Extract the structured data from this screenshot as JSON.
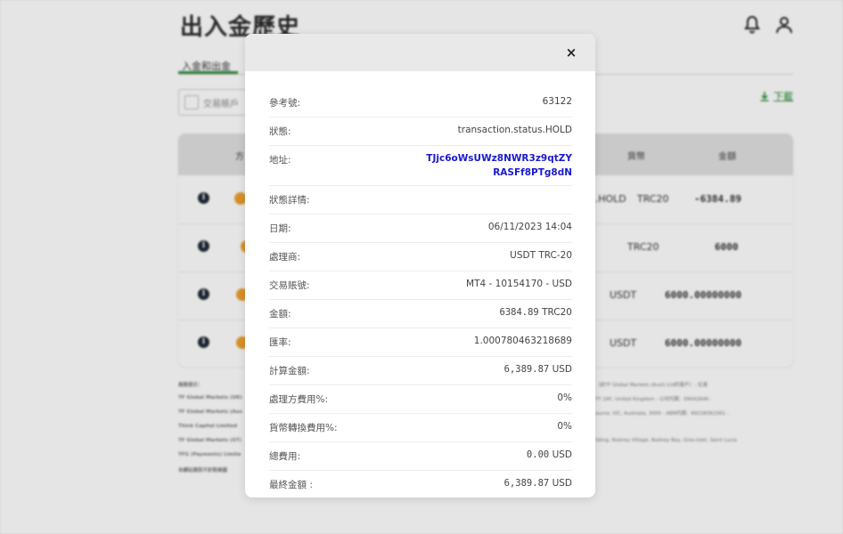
{
  "page": {
    "title": "出入金歷史",
    "tab_label": "入金和出金",
    "account_select_label": "交易賬戶",
    "download_label": "下載"
  },
  "table": {
    "headers": {
      "method": "方",
      "currency": "貨幣",
      "amount": "金額"
    },
    "rows": [
      {
        "status": "s.HOLD",
        "currency": "TRC20",
        "amount": "-6384.89"
      },
      {
        "status": "",
        "currency": "TRC20",
        "amount": "6000"
      },
      {
        "status": "",
        "currency": "USDT",
        "amount": "6000.00000000"
      },
      {
        "status": "",
        "currency": "USDT",
        "amount": "6000.00000000"
      }
    ]
  },
  "footer": {
    "lines": [
      "風險提示：",
      "TF Global Markets (UK)",
      "TF Global Markets (Aus",
      "Think Capital Limited",
      "TF Global Markets (ST)",
      "TFG (Payments) Limite",
      "本網站資訊不針對美國"
    ],
    "right_lines": [
      "（前TF Global Markets (Aust) Ltd的客戶）- 在澳",
      "TY 2AY, United Kingdom - 公司代碼：09042646 -",
      "ourne, VIC, Australia, 3000 - ABN代碼：69158361561 -",
      "",
      "ilding, Rodney Village, Rodney Bay, Gros-Islet, Saint Lucia"
    ]
  },
  "modal": {
    "close_symbol": "×",
    "rows": [
      {
        "key": "參考號:",
        "value": "63122"
      },
      {
        "key": "狀態:",
        "value": "transaction.status.HOLD"
      },
      {
        "key": "地址:",
        "value": "TJjc6oWsUWz8NWR3z9qtZYRASFf8PTg8dN"
      },
      {
        "key": "狀態詳情:",
        "value": ""
      },
      {
        "key": "日期:",
        "value": "06/11/2023 14:04"
      },
      {
        "key": "處理商:",
        "value": "USDT TRC-20"
      },
      {
        "key": "交易賬號:",
        "value": "MT4 - 10154170 - USD"
      },
      {
        "key": "金額:",
        "value": "6384.89",
        "unit": "TRC20"
      },
      {
        "key": "匯率:",
        "value": "1.000780463218689"
      },
      {
        "key": "計算金額:",
        "value": "6,389.87",
        "unit": "USD"
      },
      {
        "key": "處理方費用%:",
        "value": "0%"
      },
      {
        "key": "貨幣轉換費用%:",
        "value": "0%"
      },
      {
        "key": "總費用:",
        "value": "0.00",
        "unit": "USD"
      },
      {
        "key": "最終金額 :",
        "value": "6,389.87",
        "unit": "USD"
      }
    ]
  },
  "colors": {
    "accent": "#2e8b3c",
    "address": "#1a1acc",
    "coin": "#f0a030"
  }
}
